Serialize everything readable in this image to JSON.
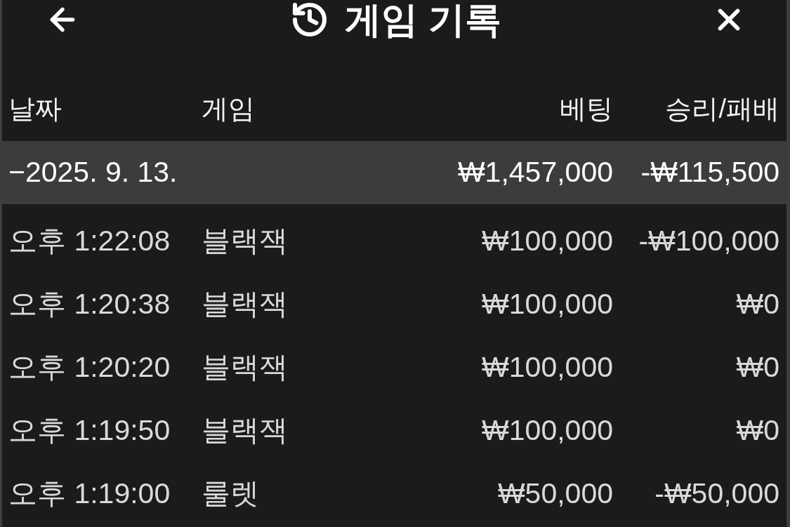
{
  "header": {
    "title": "게임 기록"
  },
  "table": {
    "columns": [
      "날짜",
      "게임",
      "베팅",
      "승리/패배"
    ],
    "groups": [
      {
        "label": "−2025. 9. 13.",
        "bet": "₩1,457,000",
        "result": "-₩115,500",
        "rows": [
          {
            "date": "오후 1:22:08",
            "game": "블랙잭",
            "bet": "₩100,000",
            "result": "-₩100,000"
          },
          {
            "date": "오후 1:20:38",
            "game": "블랙잭",
            "bet": "₩100,000",
            "result": "₩0"
          },
          {
            "date": "오후 1:20:20",
            "game": "블랙잭",
            "bet": "₩100,000",
            "result": "₩0"
          },
          {
            "date": "오후 1:19:50",
            "game": "블랙잭",
            "bet": "₩100,000",
            "result": "₩0"
          },
          {
            "date": "오후 1:19:00",
            "game": "룰렛",
            "bet": "₩50,000",
            "result": "-₩50,000"
          }
        ]
      }
    ]
  }
}
